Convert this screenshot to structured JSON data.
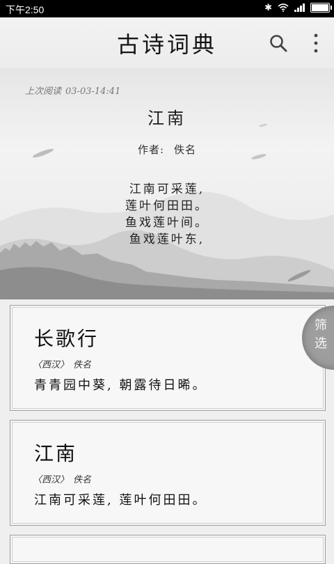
{
  "status_bar": {
    "time": "下午2:50",
    "bluetooth_icon": "bluetooth-icon",
    "wifi_icon": "wifi-icon",
    "signal_icon": "signal-icon",
    "battery_icon": "battery-icon"
  },
  "header": {
    "title": "古诗词典",
    "search_icon": "search-icon",
    "more_icon": "more-vertical-icon"
  },
  "hero": {
    "last_read_label": "上次阅读",
    "last_read_date": "03-03-14:41",
    "poem_title": "江南",
    "author_label": "作者:",
    "author": "佚名",
    "lines": [
      "江南可采莲,",
      "莲叶何田田。",
      "鱼戏莲叶间。",
      "鱼戏莲叶东,"
    ]
  },
  "poems": [
    {
      "title": "长歌行",
      "dynasty": "〈西汉〉",
      "author": "佚名",
      "excerpt": "青青园中葵, 朝露待日晞。"
    },
    {
      "title": "江南",
      "dynasty": "〈西汉〉",
      "author": "佚名",
      "excerpt": "江南可采莲, 莲叶何田田。"
    }
  ],
  "filter": {
    "label": "筛选"
  },
  "colors": {
    "background": "#efefef",
    "status_bar": "#000000",
    "card_border": "#9d9d9d",
    "filter_tab": "#9e9e9e"
  }
}
